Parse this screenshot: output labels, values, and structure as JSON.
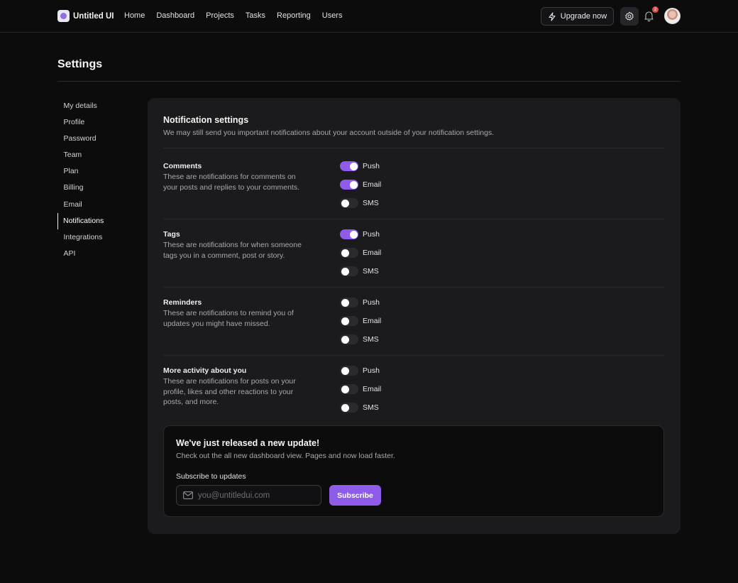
{
  "brand": {
    "name": "Untitled UI"
  },
  "nav": {
    "items": [
      "Home",
      "Dashboard",
      "Projects",
      "Tasks",
      "Reporting",
      "Users"
    ],
    "upgrade_label": "Upgrade now",
    "notification_count": "2"
  },
  "page": {
    "title": "Settings"
  },
  "sidebar": {
    "items": [
      "My details",
      "Profile",
      "Password",
      "Team",
      "Plan",
      "Billing",
      "Email",
      "Notifications",
      "Integrations",
      "API"
    ],
    "active": "Notifications"
  },
  "notification_settings": {
    "title": "Notification settings",
    "subtitle": "We may still send you important notifications about your account outside of your notification settings.",
    "sections": [
      {
        "title": "Comments",
        "description": "These are notifications for comments on your posts and replies to your comments.",
        "toggles": [
          {
            "label": "Push",
            "on": true
          },
          {
            "label": "Email",
            "on": true
          },
          {
            "label": "SMS",
            "on": false
          }
        ]
      },
      {
        "title": "Tags",
        "description": "These are notifications for when someone tags you in a comment, post or story.",
        "toggles": [
          {
            "label": "Push",
            "on": true
          },
          {
            "label": "Email",
            "on": false
          },
          {
            "label": "SMS",
            "on": false
          }
        ]
      },
      {
        "title": "Reminders",
        "description": "These are notifications to remind you of updates you might have missed.",
        "toggles": [
          {
            "label": "Push",
            "on": false
          },
          {
            "label": "Email",
            "on": false
          },
          {
            "label": "SMS",
            "on": false
          }
        ]
      },
      {
        "title": "More activity about you",
        "description": "These are notifications for posts on your profile, likes and other reactions to your posts, and more.",
        "toggles": [
          {
            "label": "Push",
            "on": false
          },
          {
            "label": "Email",
            "on": false
          },
          {
            "label": "SMS",
            "on": false
          }
        ]
      }
    ]
  },
  "update_banner": {
    "title": "We've just released a new update!",
    "subtitle": "Check out the all new dashboard view. Pages and now load faster.",
    "subscribe_label": "Subscribe to updates",
    "email_placeholder": "you@untitledui.com",
    "email_value": "",
    "button_label": "Subscribe"
  },
  "icons": [
    "logo-icon",
    "lightning-icon",
    "gear-icon",
    "bell-icon",
    "mail-icon"
  ],
  "colors": {
    "accent": "#8e5ce8",
    "background": "#0c0c0d",
    "card": "#1b1b1d",
    "badge": "#e5484d"
  }
}
